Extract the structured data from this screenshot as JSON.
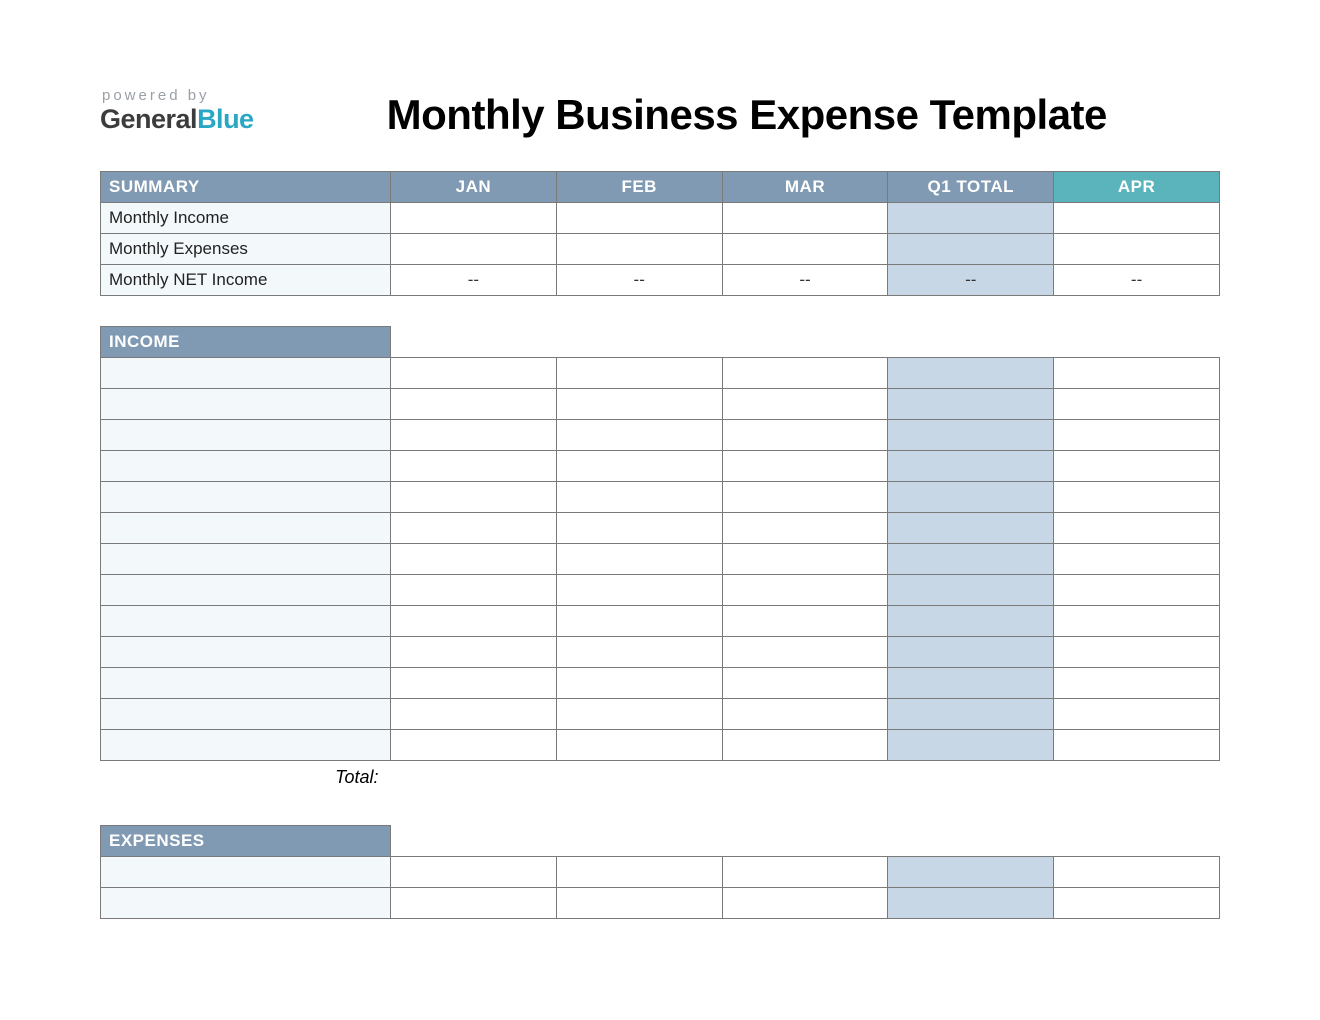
{
  "branding": {
    "powered_by": "powered by",
    "name_part1": "General",
    "name_part2": "Blue"
  },
  "title": "Monthly Business Expense Template",
  "columns": {
    "jan": "JAN",
    "feb": "FEB",
    "mar": "MAR",
    "q1": "Q1 TOTAL",
    "apr": "APR"
  },
  "summary": {
    "header": "SUMMARY",
    "rows": [
      {
        "label": "Monthly Income",
        "jan": "",
        "feb": "",
        "mar": "",
        "q1": "",
        "apr": ""
      },
      {
        "label": "Monthly Expenses",
        "jan": "",
        "feb": "",
        "mar": "",
        "q1": "",
        "apr": ""
      },
      {
        "label": "Monthly NET Income",
        "jan": "--",
        "feb": "--",
        "mar": "--",
        "q1": "--",
        "apr": "--"
      }
    ]
  },
  "income": {
    "header": "INCOME",
    "rows": [
      {
        "label": "",
        "jan": "",
        "feb": "",
        "mar": "",
        "q1": "",
        "apr": ""
      },
      {
        "label": "",
        "jan": "",
        "feb": "",
        "mar": "",
        "q1": "",
        "apr": ""
      },
      {
        "label": "",
        "jan": "",
        "feb": "",
        "mar": "",
        "q1": "",
        "apr": ""
      },
      {
        "label": "",
        "jan": "",
        "feb": "",
        "mar": "",
        "q1": "",
        "apr": ""
      },
      {
        "label": "",
        "jan": "",
        "feb": "",
        "mar": "",
        "q1": "",
        "apr": ""
      },
      {
        "label": "",
        "jan": "",
        "feb": "",
        "mar": "",
        "q1": "",
        "apr": ""
      },
      {
        "label": "",
        "jan": "",
        "feb": "",
        "mar": "",
        "q1": "",
        "apr": ""
      },
      {
        "label": "",
        "jan": "",
        "feb": "",
        "mar": "",
        "q1": "",
        "apr": ""
      },
      {
        "label": "",
        "jan": "",
        "feb": "",
        "mar": "",
        "q1": "",
        "apr": ""
      },
      {
        "label": "",
        "jan": "",
        "feb": "",
        "mar": "",
        "q1": "",
        "apr": ""
      },
      {
        "label": "",
        "jan": "",
        "feb": "",
        "mar": "",
        "q1": "",
        "apr": ""
      },
      {
        "label": "",
        "jan": "",
        "feb": "",
        "mar": "",
        "q1": "",
        "apr": ""
      },
      {
        "label": "",
        "jan": "",
        "feb": "",
        "mar": "",
        "q1": "",
        "apr": ""
      }
    ],
    "total_label": "Total:"
  },
  "expenses": {
    "header": "EXPENSES",
    "rows": [
      {
        "label": "",
        "jan": "",
        "feb": "",
        "mar": "",
        "q1": "",
        "apr": ""
      },
      {
        "label": "",
        "jan": "",
        "feb": "",
        "mar": "",
        "q1": "",
        "apr": ""
      }
    ]
  }
}
